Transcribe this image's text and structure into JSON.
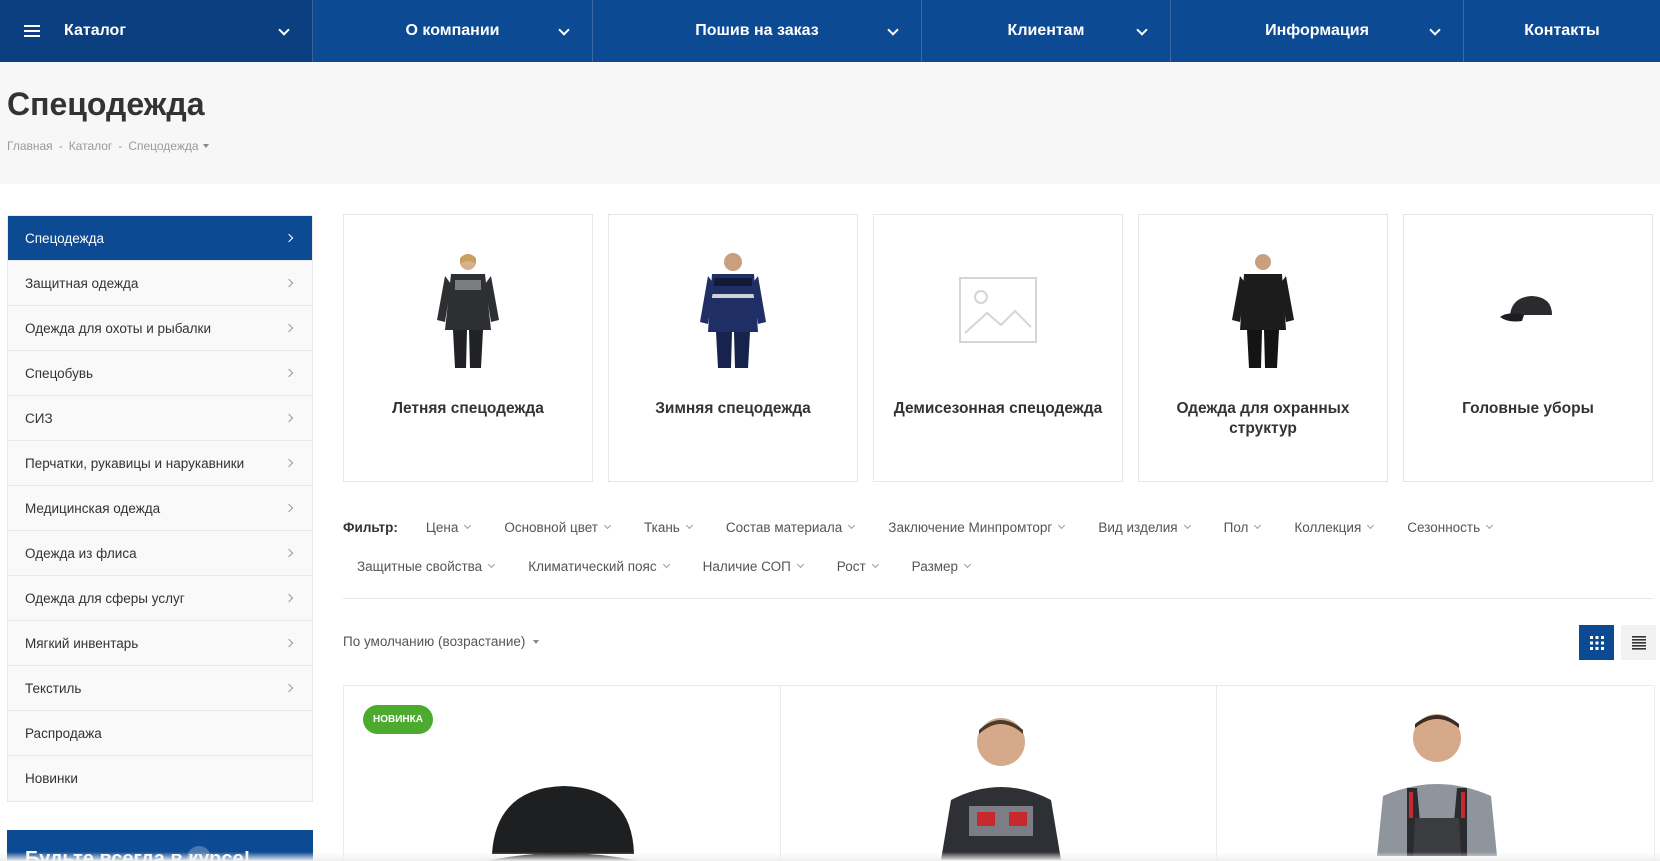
{
  "nav": {
    "catalog": "Каталог",
    "items": [
      {
        "label": "О компании"
      },
      {
        "label": "Пошив на заказ"
      },
      {
        "label": "Клиентам"
      },
      {
        "label": "Информация"
      },
      {
        "label": "Контакты"
      }
    ]
  },
  "page": {
    "title": "Спецодежда",
    "breadcrumb": [
      "Главная",
      "Каталог",
      "Спецодежда"
    ]
  },
  "sidebar": {
    "items": [
      {
        "label": "Спецодежда"
      },
      {
        "label": "Защитная одежда"
      },
      {
        "label": "Одежда для охоты и рыбалки"
      },
      {
        "label": "Спецобувь"
      },
      {
        "label": "СИЗ"
      },
      {
        "label": "Перчатки, рукавицы и нарукавники"
      },
      {
        "label": "Медицинская одежда"
      },
      {
        "label": "Одежда из флиса"
      },
      {
        "label": "Одежда для сферы услуг"
      },
      {
        "label": "Мягкий инвентарь"
      },
      {
        "label": "Текстиль"
      },
      {
        "label": "Распродажа"
      },
      {
        "label": "Новинки"
      }
    ],
    "subscribe": "Будьте всегда в курсе!"
  },
  "categories": [
    {
      "title": "Летняя спецодежда"
    },
    {
      "title": "Зимняя спецодежда"
    },
    {
      "title": "Демисезонная спецодежда"
    },
    {
      "title": "Одежда для охранных структур"
    },
    {
      "title": "Головные уборы"
    }
  ],
  "filter": {
    "label": "Фильтр:",
    "row1": [
      "Цена",
      "Основной цвет",
      "Ткань",
      "Состав материала",
      "Заключение Минпромторг",
      "Вид изделия",
      "Пол",
      "Коллекция",
      "Сезонность"
    ],
    "row2": [
      "Защитные свойства",
      "Климатический пояс",
      "Наличие СОП",
      "Рост",
      "Размер"
    ]
  },
  "sort": {
    "label": "По умолчанию (возрастание)"
  },
  "products": [
    {
      "badge": "НОВИНКА"
    },
    {
      "badge": ""
    },
    {
      "badge": ""
    }
  ],
  "colors": {
    "primary": "#0c4a94",
    "badge": "#4caa2e"
  }
}
